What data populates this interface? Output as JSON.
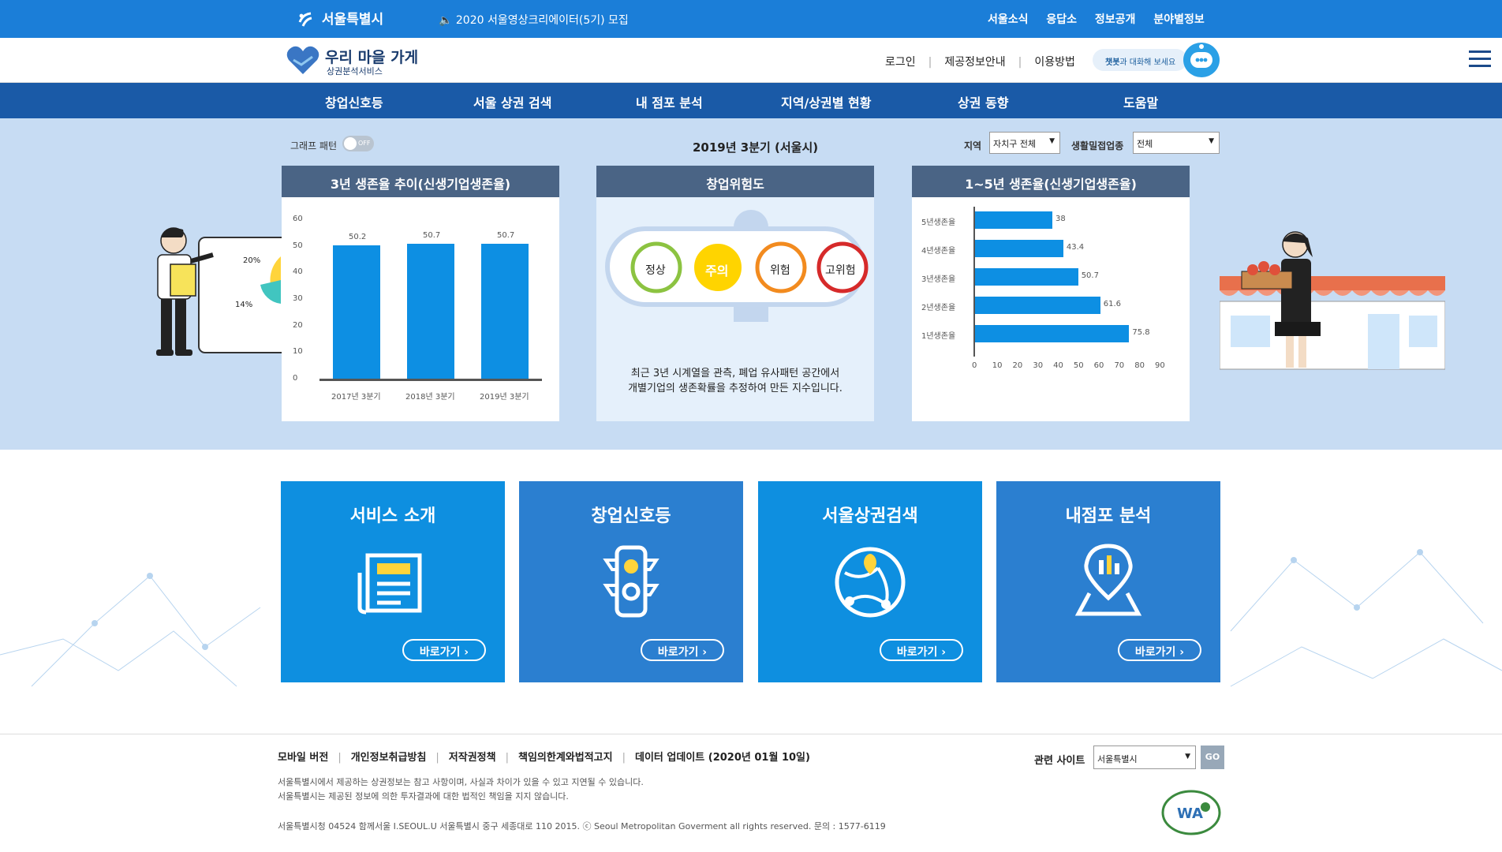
{
  "topbar": {
    "logo": "서울특별시",
    "notice": "2020 서울영상크리에이터(5기) 모집",
    "links": [
      "서울소식",
      "응답소",
      "정보공개",
      "분야별정보"
    ]
  },
  "header": {
    "brand_title": "우리 마을 가게",
    "brand_sub": "상권분석서비스",
    "links": [
      "로그인",
      "제공정보안내",
      "이용방법"
    ],
    "chat_bold": "챗봇",
    "chat_text": "과 대화해 보세요"
  },
  "nav": [
    "창업신호등",
    "서울 상권 검색",
    "내 점포 분석",
    "지역/상권별 현황",
    "상권 동향",
    "도움말"
  ],
  "dashboard": {
    "graph_pattern_label": "그래프 패턴",
    "toggle_state": "OFF",
    "period": "2019년 3분기 (서울시)",
    "region_label": "지역",
    "region_value": "자치구 전체",
    "industry_label": "생활밀접업종",
    "industry_value": "전체",
    "panel1_title": "3년 생존율 추이(신생기업생존율)",
    "panel2_title": "창업위험도",
    "panel3_title": "1~5년 생존율(신생기업생존율)",
    "signals": [
      "정상",
      "주의",
      "위험",
      "고위험"
    ],
    "active_signal": "주의",
    "desc_line1": "최근 3년 시계열을 관측, 폐업 유사패턴 공간에서",
    "desc_line2": "개별기업의 생존확률을 추정하여 만든 지수입니다.",
    "illustration_labels": [
      "20%",
      "14%"
    ]
  },
  "chart_data": [
    {
      "type": "bar",
      "title": "3년 생존율 추이(신생기업생존율)",
      "categories": [
        "2017년 3분기",
        "2018년 3분기",
        "2019년 3분기"
      ],
      "values": [
        50.2,
        50.7,
        50.7
      ],
      "value_labels": [
        "50.2",
        "50.7",
        "50.7"
      ],
      "yticks": [
        "0",
        "10",
        "20",
        "30",
        "40",
        "50",
        "60"
      ],
      "ylim": [
        0,
        60
      ]
    },
    {
      "type": "bar",
      "orientation": "horizontal",
      "title": "1~5년 생존율(신생기업생존율)",
      "categories": [
        "5년생존율",
        "4년생존율",
        "3년생존율",
        "2년생존율",
        "1년생존율"
      ],
      "values": [
        38,
        43.4,
        50.7,
        61.6,
        75.8
      ],
      "value_labels": [
        "38",
        "43.4",
        "50.7",
        "61.6",
        "75.8"
      ],
      "xticks": [
        "0",
        "10",
        "20",
        "30",
        "40",
        "50",
        "60",
        "70",
        "80",
        "90"
      ],
      "xlim": [
        0,
        90
      ]
    }
  ],
  "cards": [
    {
      "title": "서비스 소개",
      "button": "바로가기",
      "color": "#0e8fe0"
    },
    {
      "title": "창업신호등",
      "button": "바로가기",
      "color": "#2b7fd0"
    },
    {
      "title": "서울상권검색",
      "button": "바로가기",
      "color": "#0e8fe0"
    },
    {
      "title": "내점포 분석",
      "button": "바로가기",
      "color": "#2b7fd0"
    }
  ],
  "footer": {
    "links": [
      "모바일 버전",
      "개인정보취급방침",
      "저작권정책",
      "책임의한계와법적고지",
      "데이터 업데이트 (2020년 01월 10일)"
    ],
    "notice1": "서울특별시에서 제공하는 상권정보는 참고 사항이며, 사실과 차이가 있을 수 있고 지연될 수 있습니다.",
    "notice2": "서울특별시는 제공된 정보에 의한 투자결과에 대한 법적인 책임을 지지 않습니다.",
    "address": "서울특별시청 04524 함께서울 I.SEOUL.U 서울특별시 중구 세종대로 110 2015. ⓒ Seoul Metropolitan Goverment all rights reserved. 문의 : 1577-6119",
    "related_label": "관련 사이트",
    "related_value": "서울특별시",
    "go": "GO",
    "wa_badge": "WA"
  }
}
